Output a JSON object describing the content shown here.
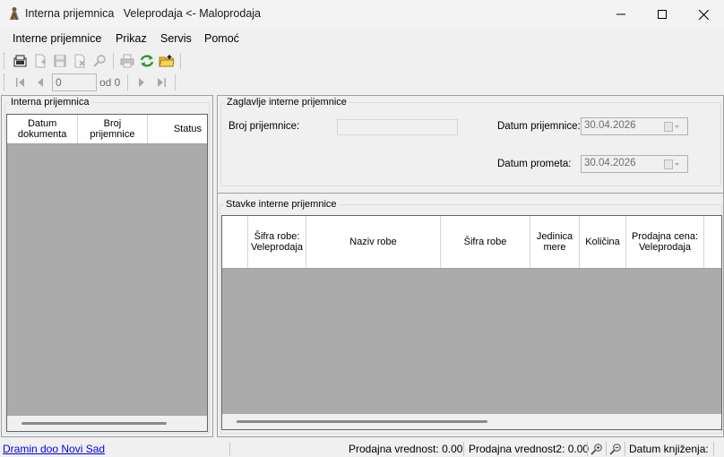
{
  "window": {
    "title": "Interna prijemnica   Veleprodaja <- Maloprodaja"
  },
  "menu": {
    "items": [
      "Interne prijemnice",
      "Prikaz",
      "Servis",
      "Pomoć"
    ]
  },
  "toolbar": {
    "icons": [
      "new-document-icon",
      "add-icon",
      "save-icon",
      "delete-icon",
      "search-icon",
      "print-icon",
      "refresh-icon",
      "open-folder-icon"
    ]
  },
  "navigator": {
    "position_value": "0",
    "of_label": "od 0"
  },
  "left_panel": {
    "group_title": "Interna prijemnica",
    "columns": [
      "Datum dokumenta",
      "Broj prijemnice",
      "Status"
    ]
  },
  "header_group": {
    "title": "Zaglavlje interne prijemnice",
    "broj_label": "Broj prijemnice:",
    "broj_value": "",
    "datum_prijemnice_label": "Datum prijemnice:",
    "datum_prijemnice_value": "30.04.2026",
    "datum_prometa_label": "Datum prometa:",
    "datum_prometa_value": "30.04.2026"
  },
  "items_group": {
    "title": "Stavke interne prijemnice",
    "columns": [
      "",
      "Šifra robe: Veleprodaja",
      "Naziv robe",
      "Šifra robe",
      "Jedinica mere",
      "Količina",
      "Prodajna cena: Veleprodaja"
    ]
  },
  "statusbar": {
    "company": "Dramin doo Novi Sad",
    "prodajna_vrednost": "Prodajna vrednost: 0.00",
    "prodajna_vrednost2": "Prodajna vrednost2: 0.00",
    "datum_knjizenja": "Datum knjiženja:"
  },
  "colors": {
    "grid_background": "#ababab",
    "link": "#0000ee",
    "window_background": "#f0f0f0"
  }
}
